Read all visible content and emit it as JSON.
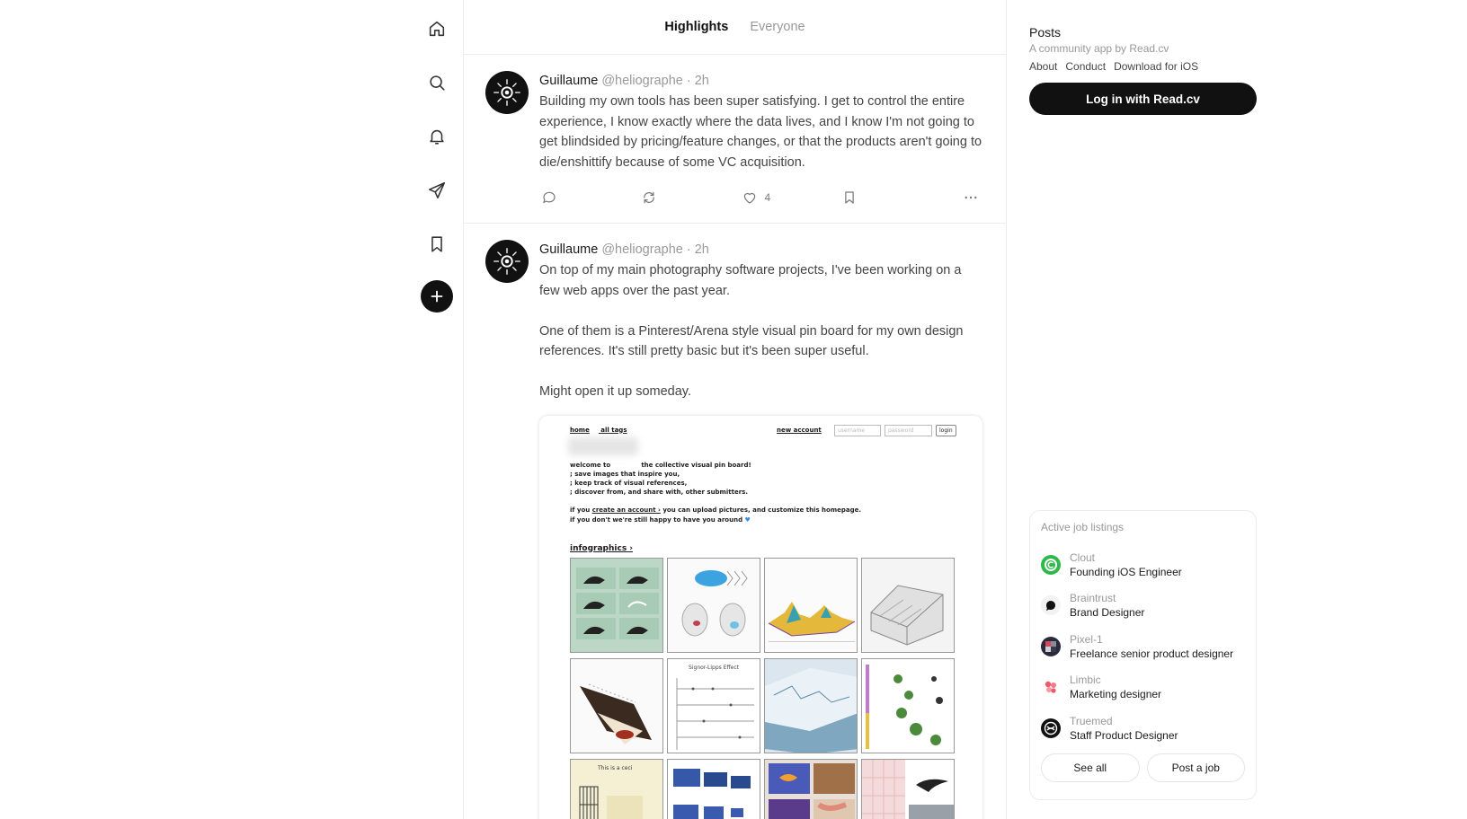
{
  "tabs": {
    "highlights": "Highlights",
    "everyone": "Everyone"
  },
  "posts": [
    {
      "author": "Guillaume",
      "handle": "@heliographe · 2h",
      "text": "Building my own tools has been super satisfying. I get to control the entire experience, I know exactly where the data lives, and I know I'm not going to get blindsided by pricing/feature changes, or that the products aren't going to die/enshittify because of some VC acquisition.",
      "likes": "4"
    },
    {
      "author": "Guillaume",
      "handle": "@heliographe · 2h",
      "text": "On top of my main photography software projects, I've been working on a few web apps over the past year.\n\nOne of them is a Pinterest/Arena style visual pin board for my own design references. It's still pretty basic but it's been super useful.\n\nMight open it up someday."
    }
  ],
  "pinboard": {
    "home": "home",
    "all_tags": "all tags",
    "new_account": "new account",
    "username_ph": "username",
    "password_ph": "password",
    "login": "login",
    "welcome": "welcome to              the collective visual pin board!\n; save images that inspire you,\n; keep track of visual references,\n; discover from, and share with, other submitters.",
    "account_line_1a": "if you ",
    "account_link": "create an account ›",
    "account_line_1b": " you can upload pictures, and customize this homepage.",
    "account_line_2": "if you don't we're still happy to have you around",
    "infographics": "infographics ›",
    "thumb_signor": "Signor-Lipps Effect",
    "thumb_caption_this": "This is a ceci"
  },
  "sidebar": {
    "title": "Posts",
    "subtitle": "A community app by Read.cv",
    "links": [
      "About",
      "Conduct",
      "Download for iOS"
    ],
    "login": "Log in with Read.cv"
  },
  "jobs": {
    "title": "Active job listings",
    "items": [
      {
        "company": "Clout",
        "role": "Founding iOS Engineer",
        "color": "#2fb84a"
      },
      {
        "company": "Braintrust",
        "role": "Brand Designer",
        "color": "#f0f0f0"
      },
      {
        "company": "Pixel-1",
        "role": "Freelance senior product designer",
        "color": "#2a2a3a"
      },
      {
        "company": "Limbic",
        "role": "Marketing designer",
        "color": "#ffffff"
      },
      {
        "company": "Truemed",
        "role": "Staff Product Designer",
        "color": "#111111"
      }
    ],
    "see_all": "See all",
    "post_job": "Post a job"
  }
}
